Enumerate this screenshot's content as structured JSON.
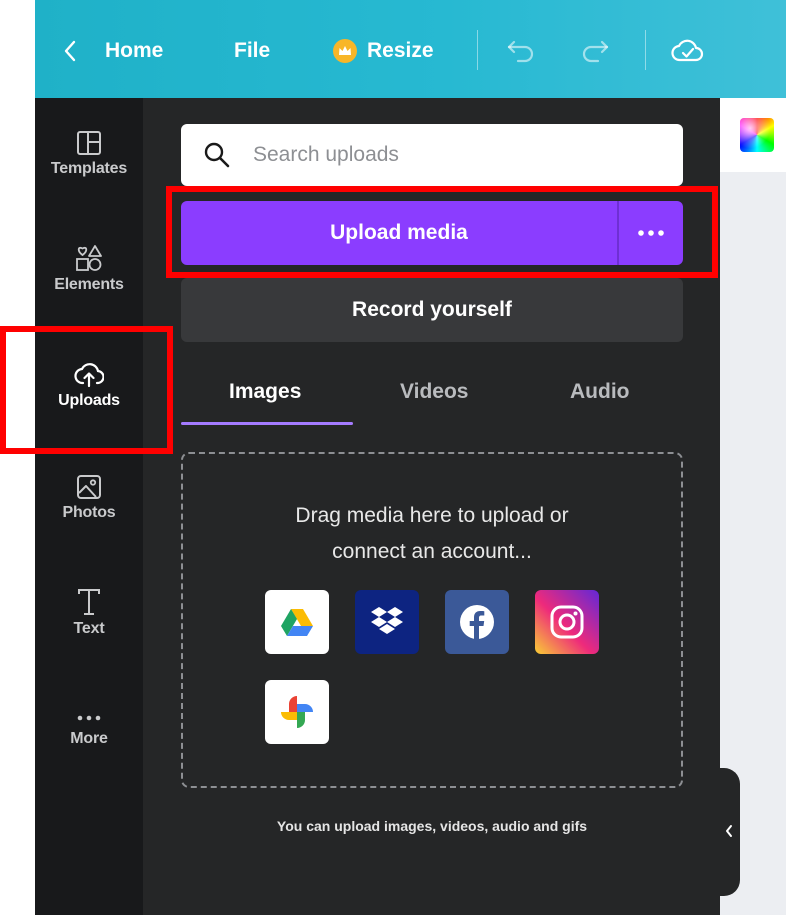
{
  "topbar": {
    "home_label": "Home",
    "file_label": "File",
    "resize_label": "Resize"
  },
  "sidenav": {
    "items": [
      {
        "label": "Templates",
        "icon": "templates-icon"
      },
      {
        "label": "Elements",
        "icon": "elements-icon"
      },
      {
        "label": "Uploads",
        "icon": "upload-cloud-icon",
        "active": true
      },
      {
        "label": "Photos",
        "icon": "image-icon"
      },
      {
        "label": "Text",
        "icon": "text-icon"
      },
      {
        "label": "More",
        "icon": "more-dots-icon"
      }
    ]
  },
  "panel": {
    "search_placeholder": "Search uploads",
    "upload_label": "Upload media",
    "record_label": "Record yourself",
    "tabs": [
      {
        "label": "Images",
        "active": true
      },
      {
        "label": "Videos"
      },
      {
        "label": "Audio"
      }
    ],
    "drop_line1": "Drag media here to upload or",
    "drop_line2": "connect an account...",
    "sources": [
      {
        "name": "Google Drive",
        "icon": "google-drive-icon"
      },
      {
        "name": "Dropbox",
        "icon": "dropbox-icon"
      },
      {
        "name": "Facebook",
        "icon": "facebook-icon"
      },
      {
        "name": "Instagram",
        "icon": "instagram-icon"
      },
      {
        "name": "Google Photos",
        "icon": "google-photos-icon"
      }
    ],
    "footnote": "You can upload images, videos, audio and gifs"
  },
  "colors": {
    "topbar": "#1fb1c8",
    "sidebar": "#18191b",
    "panel": "#252627",
    "accent_purple": "#8b3dff",
    "highlight_red": "#ff0000"
  }
}
